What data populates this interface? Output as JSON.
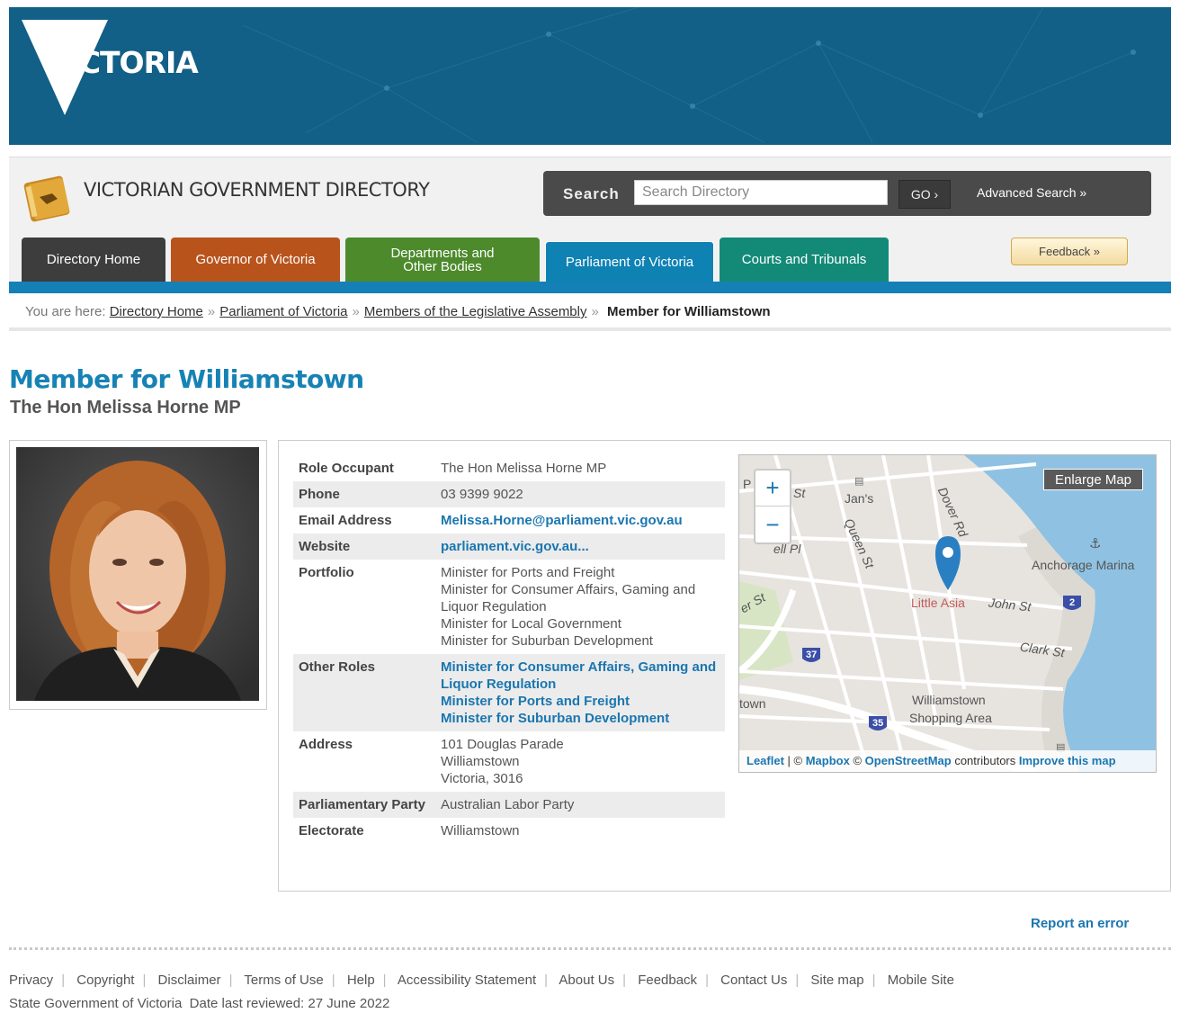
{
  "banner": {
    "logo_text": "VICTORIA"
  },
  "header": {
    "directory_title": "VICTORIAN GOVERNMENT DIRECTORY",
    "search_label": "Search",
    "search_placeholder": "Search Directory",
    "go_label": "GO ›",
    "advanced_search": "Advanced Search »",
    "feedback": "Feedback »"
  },
  "tabs": {
    "home": "Directory Home",
    "governor": "Governor of Victoria",
    "departments_line1": "Departments and",
    "departments_line2": "Other Bodies",
    "parliament": "Parliament of Victoria",
    "courts": "Courts and Tribunals"
  },
  "breadcrumb": {
    "prefix": "You are here:",
    "items": [
      "Directory Home",
      "Parliament of Victoria",
      "Members of the Legislative Assembly"
    ],
    "separator": "»",
    "current": "Member for Williamstown"
  },
  "page": {
    "title": "Member for Williamstown",
    "subtitle": "The Hon Melissa Horne MP"
  },
  "details": {
    "role_occupant_label": "Role Occupant",
    "role_occupant": "The Hon Melissa Horne MP",
    "phone_label": "Phone",
    "phone": "03 9399 9022",
    "email_label": "Email Address",
    "email": "Melissa.Horne@parliament.vic.gov.au",
    "website_label": "Website",
    "website": "parliament.vic.gov.au...",
    "portfolio_label": "Portfolio",
    "portfolio": [
      "Minister for Ports and Freight",
      "Minister for Consumer Affairs, Gaming and Liquor Regulation",
      "Minister for Local Government",
      "Minister for Suburban Development"
    ],
    "other_roles_label": "Other Roles",
    "other_roles": [
      "Minister for Consumer Affairs, Gaming and Liquor Regulation",
      "Minister for Ports and Freight",
      "Minister for Suburban Development"
    ],
    "address_label": "Address",
    "address": [
      "101 Douglas Parade",
      "Williamstown",
      "Victoria, 3016"
    ],
    "party_label": "Parliamentary Party",
    "party": "Australian Labor Party",
    "electorate_label": "Electorate",
    "electorate": "Williamstown"
  },
  "map": {
    "enlarge": "Enlarge Map",
    "zoom_in": "+",
    "zoom_out": "−",
    "labels": {
      "jans": "Jan's",
      "queen_st": "Queen St",
      "dover_rd": "Dover Rd",
      "anchorage": "Anchorage Marina",
      "little_asia": "Little Asia",
      "john_st": "John St",
      "clark_st": "Clark St",
      "shopping": "Williamstown",
      "shopping2": "Shopping Area",
      "town": "town",
      "st": "St",
      "p": "P",
      "ell_pl": "ell Pl",
      "er_st": "er St",
      "shield_37": "37",
      "shield_35": "35",
      "shield_2": "2"
    },
    "attribution": {
      "leaflet": "Leaflet",
      "pipe": " | © ",
      "mapbox": "Mapbox",
      "copy": " © ",
      "osm": "OpenStreetMap",
      "contrib": " contributors ",
      "improve": "Improve this map"
    }
  },
  "footer": {
    "report_error": "Report an error",
    "links": [
      "Privacy",
      "Copyright",
      "Disclaimer",
      "Terms of Use",
      "Help",
      "Accessibility Statement",
      "About Us",
      "Feedback",
      "Contact Us",
      "Site map",
      "Mobile Site"
    ],
    "note": "State Government of Victoria  Date last reviewed: 27 June 2022"
  },
  "colors": {
    "banner": "#125f87",
    "accent": "#1782b4",
    "link": "#1a76b0",
    "tab_home": "#3d3d3d",
    "tab_governor": "#b8531c",
    "tab_departments": "#4c8a2c",
    "tab_parliament": "#0f82b4",
    "tab_courts": "#138a78"
  }
}
